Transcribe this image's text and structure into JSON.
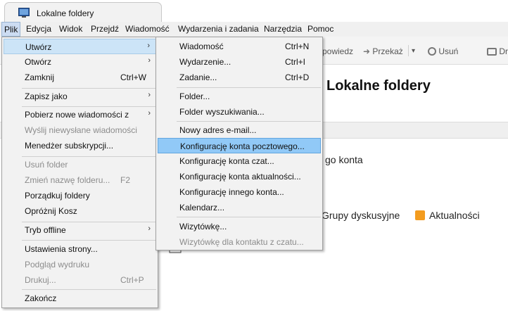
{
  "window": {
    "tab_title": "Lokalne foldery"
  },
  "menubar": {
    "items": [
      "Plik",
      "Edycja",
      "Widok",
      "Przejdź",
      "Wiadomość",
      "Wydarzenia i zadania",
      "Narzędzia",
      "Pomoc"
    ]
  },
  "toolbar": {
    "reply_fragment": "powiedz",
    "forward": "Przekaż",
    "delete": "Usuń",
    "print_fragment": "Dr"
  },
  "content": {
    "title": "Lokalne foldery",
    "accounts_fragment": "go konta",
    "newsgroups_fragment": "Grupy dyskusyjne",
    "feeds": "Aktualności"
  },
  "plik_menu": {
    "items": [
      {
        "label": "Utwórz",
        "arrow": "›"
      },
      {
        "label": "Otwórz",
        "arrow": "›"
      },
      {
        "label": "Zamknij",
        "shortcut": "Ctrl+W"
      },
      {
        "label": "Zapisz jako",
        "arrow": "›"
      },
      {
        "label": "Pobierz nowe wiadomości z",
        "arrow": "›"
      },
      {
        "label": "Wyślij niewysłane wiadomości"
      },
      {
        "label": "Menedżer subskrypcji..."
      },
      {
        "label": "Usuń folder"
      },
      {
        "label": "Zmień nazwę folderu...",
        "shortcut": "F2"
      },
      {
        "label": "Porządkuj foldery"
      },
      {
        "label": "Opróżnij Kosz"
      },
      {
        "label": "Tryb offline",
        "arrow": "›"
      },
      {
        "label": "Ustawienia strony..."
      },
      {
        "label": "Podgląd wydruku"
      },
      {
        "label": "Drukuj...",
        "shortcut": "Ctrl+P"
      },
      {
        "label": "Zakończ"
      }
    ]
  },
  "utworz_menu": {
    "items": [
      {
        "label": "Wiadomość",
        "shortcut": "Ctrl+N"
      },
      {
        "label": "Wydarzenie...",
        "shortcut": "Ctrl+I"
      },
      {
        "label": "Zadanie...",
        "shortcut": "Ctrl+D"
      },
      {
        "label": "Folder..."
      },
      {
        "label": "Folder wyszukiwania..."
      },
      {
        "label": "Nowy adres e-mail..."
      },
      {
        "label": "Konfigurację konta pocztowego..."
      },
      {
        "label": "Konfigurację konta czat..."
      },
      {
        "label": "Konfigurację konta aktualności..."
      },
      {
        "label": "Konfigurację innego konta..."
      },
      {
        "label": "Kalendarz..."
      },
      {
        "label": "Wizytówkę..."
      },
      {
        "label": "Wizytówkę dla kontaktu z czatu..."
      }
    ]
  },
  "colors": {
    "menu_bg": "#f2f2f2",
    "highlight": "#91c9f7",
    "menubar_active": "#ccdcf2",
    "disabled_text": "#8c8c8c",
    "rss": "#f39c1f"
  },
  "icons": [
    "thunderbird-window-icon",
    "chevron-right-icon",
    "forward-arrow-icon",
    "dropdown-arrow-icon",
    "delete-circle-icon",
    "printer-icon",
    "rss-icon",
    "folder-icon"
  ]
}
